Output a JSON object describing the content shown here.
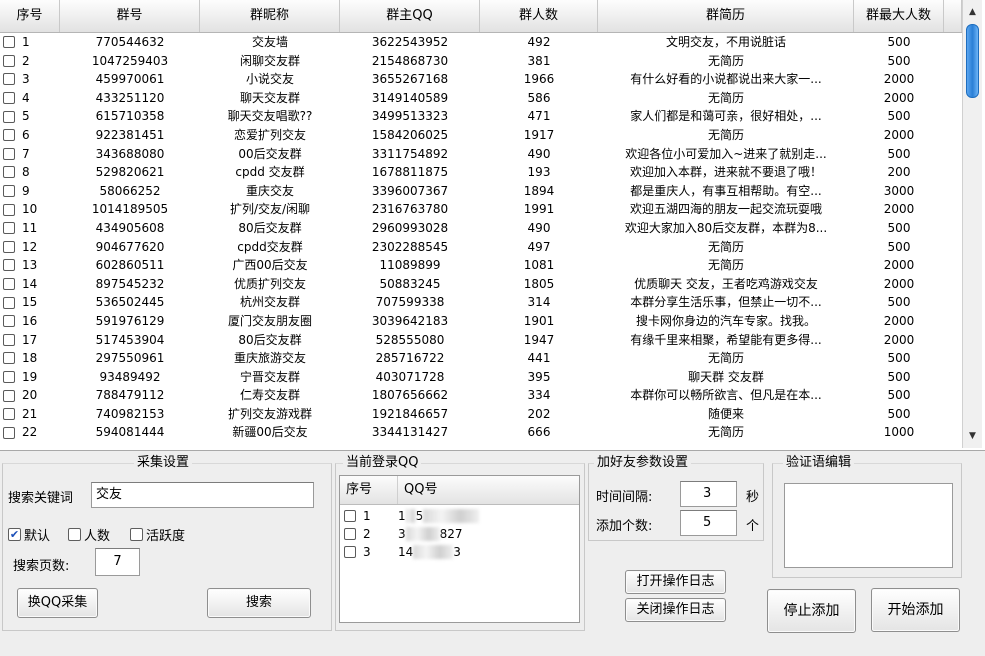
{
  "table": {
    "columns": [
      "序号",
      "群号",
      "群昵称",
      "群主QQ",
      "群人数",
      "群简历",
      "群最大人数"
    ],
    "rows": [
      [
        "1",
        "770544632",
        "交友墙",
        "3622543952",
        "492",
        "文明交友，不用说脏话",
        "500"
      ],
      [
        "2",
        "1047259403",
        "闲聊交友群",
        "2154868730",
        "381",
        "无简历",
        "500"
      ],
      [
        "3",
        "459970061",
        "小说交友",
        "3655267168",
        "1966",
        "有什么好看的小说都说出来大家一...",
        "2000"
      ],
      [
        "4",
        "433251120",
        "聊天交友群",
        "3149140589",
        "586",
        "无简历",
        "2000"
      ],
      [
        "5",
        "615710358",
        "聊天交友唱歌??",
        "3499513323",
        "471",
        "家人们都是和蔼可亲，很好相处，...",
        "500"
      ],
      [
        "6",
        "922381451",
        "恋爱扩列交友",
        "1584206025",
        "1917",
        "无简历",
        "2000"
      ],
      [
        "7",
        "343688080",
        "00后交友群",
        "3311754892",
        "490",
        "欢迎各位小可爱加入~进来了就别走...",
        "500"
      ],
      [
        "8",
        "529820621",
        "cpdd 交友群",
        "1678811875",
        "193",
        "欢迎加入本群，进来就不要退了哦！",
        "200"
      ],
      [
        "9",
        "58066252",
        "重庆交友",
        "3396007367",
        "1894",
        "都是重庆人，有事互相帮助。有空...",
        "3000"
      ],
      [
        "10",
        "1014189505",
        "扩列/交友/闲聊",
        "2316763780",
        "1991",
        "欢迎五湖四海的朋友一起交流玩耍哦",
        "2000"
      ],
      [
        "11",
        "434905608",
        "80后交友群",
        "2960993028",
        "490",
        "欢迎大家加入80后交友群，本群为8...",
        "500"
      ],
      [
        "12",
        "904677620",
        "cpdd交友群",
        "2302288545",
        "497",
        "无简历",
        "500"
      ],
      [
        "13",
        "602860511",
        "广西00后交友",
        "11089899",
        "1081",
        "无简历",
        "2000"
      ],
      [
        "14",
        "897545232",
        "优质扩列交友",
        "50883245",
        "1805",
        "优质聊天 交友，王者吃鸡游戏交友",
        "2000"
      ],
      [
        "15",
        "536502445",
        "杭州交友群",
        "707599338",
        "314",
        "本群分享生活乐事，但禁止一切不...",
        "500"
      ],
      [
        "16",
        "591976129",
        "厦门交友朋友圈",
        "3039642183",
        "1901",
        "搜卡网你身边的汽车专家。找我。",
        "2000"
      ],
      [
        "17",
        "517453904",
        "80后交友群",
        "528555080",
        "1947",
        "有缘千里来相聚，希望能有更多得...",
        "2000"
      ],
      [
        "18",
        "297550961",
        "重庆旅游交友",
        "285716722",
        "441",
        "无简历",
        "500"
      ],
      [
        "19",
        "93489492",
        "宁晋交友群",
        "403071728",
        "395",
        "聊天群 交友群",
        "500"
      ],
      [
        "20",
        "788479112",
        "仁寿交友群",
        "1807656662",
        "334",
        "本群你可以畅所欲言、但凡是在本...",
        "500"
      ],
      [
        "21",
        "740982153",
        "扩列交友游戏群",
        "1921846657",
        "202",
        "随便来",
        "500"
      ],
      [
        "22",
        "594081444",
        "新疆00后交友",
        "3344131427",
        "666",
        "无简历",
        "1000"
      ]
    ]
  },
  "collect": {
    "title": "采集设置",
    "keyword_label": "搜索关键词",
    "keyword_value": "交友",
    "opt_default": "默认",
    "opt_members": "人数",
    "opt_active": "活跃度",
    "pages_label": "搜索页数:",
    "pages_value": "7",
    "switch_button": "换QQ采集",
    "search_button": "搜索"
  },
  "login": {
    "title": "当前登录QQ",
    "col_index": "序号",
    "col_qq": "QQ号",
    "rows": [
      {
        "index": "1",
        "qq_start": "1",
        "qq_mid": "5",
        "qq_end": ""
      },
      {
        "index": "2",
        "qq_start": "3",
        "qq_mid": "",
        "qq_end": "827"
      },
      {
        "index": "3",
        "qq_start": "14",
        "qq_mid": "",
        "qq_end": "3"
      }
    ]
  },
  "params": {
    "title": "加好友参数设置",
    "interval_label": "时间间隔:",
    "interval_value": "3",
    "interval_unit": "秒",
    "count_label": "添加个数:",
    "count_value": "5",
    "count_unit": "个"
  },
  "verify": {
    "title": "验证语编辑"
  },
  "actions": {
    "open_log": "打开操作日志",
    "close_log": "关闭操作日志",
    "stop": "停止添加",
    "start": "开始添加"
  },
  "scrollbar": {
    "up_icon": "▲",
    "down_icon": "▼"
  }
}
